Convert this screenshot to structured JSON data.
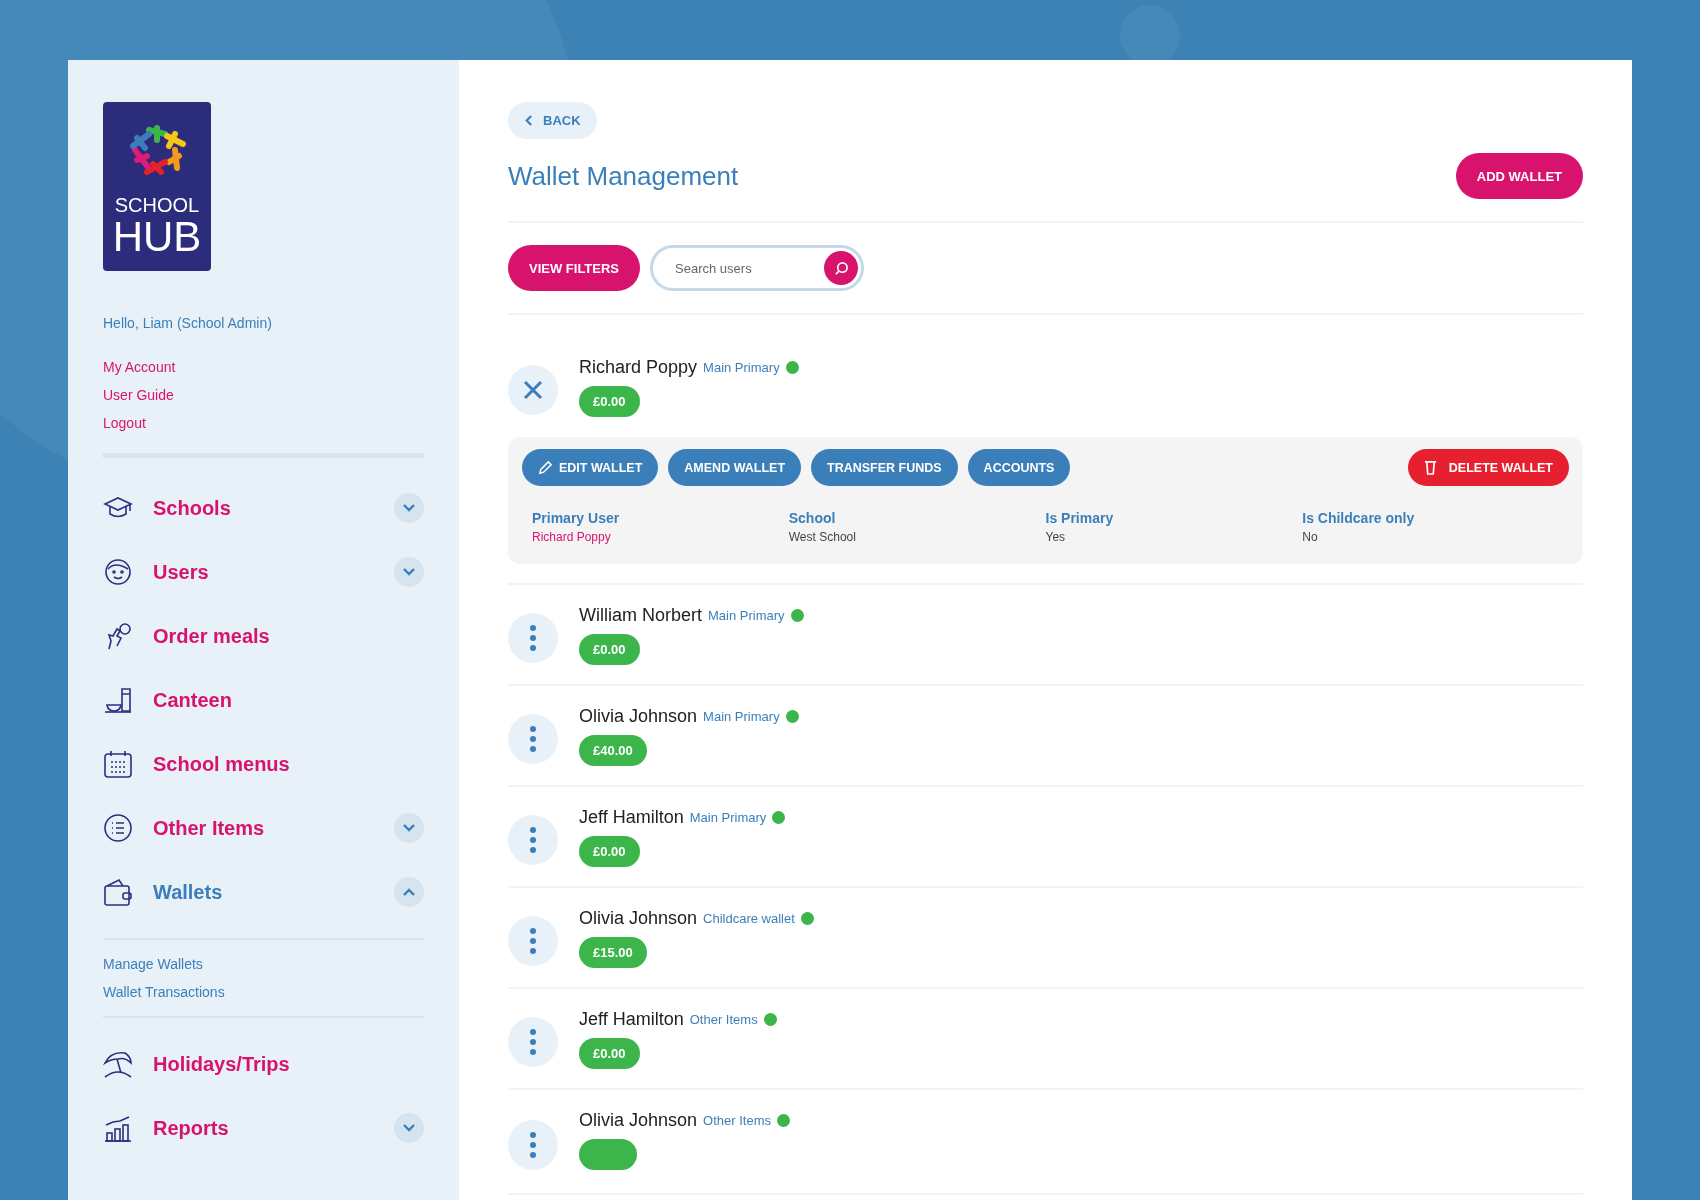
{
  "logo": {
    "line1": "SCHOOL",
    "line2": "HUB"
  },
  "greeting": "Hello, Liam (School Admin)",
  "account_links": [
    "My Account",
    "User Guide",
    "Logout"
  ],
  "sidebar": {
    "items": [
      {
        "label": "Schools",
        "selected": false,
        "expanded": false
      },
      {
        "label": "Users",
        "selected": false,
        "expanded": false
      },
      {
        "label": "Order meals",
        "selected": false
      },
      {
        "label": "Canteen",
        "selected": false
      },
      {
        "label": "School menus",
        "selected": false
      },
      {
        "label": "Other Items",
        "selected": false,
        "expanded": false
      },
      {
        "label": "Wallets",
        "selected": true,
        "expanded": true,
        "children": [
          {
            "label": "Manage Wallets"
          },
          {
            "label": "Wallet Transactions"
          }
        ]
      },
      {
        "label": "Holidays/Trips",
        "selected": false
      },
      {
        "label": "Reports",
        "selected": false,
        "expanded": false
      }
    ]
  },
  "back_button": "BACK",
  "title": "Wallet Management",
  "add_button": "ADD WALLET",
  "filters_button": "VIEW FILTERS",
  "search": {
    "placeholder": "Search users"
  },
  "wallets": [
    {
      "name": "Richard Poppy",
      "type": "Main Primary",
      "balance": "£0.00",
      "expanded": true,
      "actions": [
        {
          "label": "EDIT WALLET",
          "kind": "edit"
        },
        {
          "label": "AMEND WALLET",
          "kind": "plain"
        },
        {
          "label": "TRANSFER FUNDS",
          "kind": "plain"
        },
        {
          "label": "ACCOUNTS",
          "kind": "plain"
        },
        {
          "label": "DELETE WALLET",
          "kind": "delete"
        }
      ],
      "details": [
        {
          "label": "Primary User",
          "value": "Richard Poppy",
          "kind": "link"
        },
        {
          "label": "School",
          "value": "West School",
          "kind": "text"
        },
        {
          "label": "Is Primary",
          "value": "Yes",
          "kind": "text"
        },
        {
          "label": "Is Childcare only",
          "value": "No",
          "kind": "text"
        }
      ]
    },
    {
      "name": "William Norbert",
      "type": "Main Primary",
      "balance": "£0.00",
      "expanded": false
    },
    {
      "name": "Olivia Johnson",
      "type": "Main Primary",
      "balance": "£40.00",
      "expanded": false
    },
    {
      "name": "Jeff Hamilton",
      "type": "Main Primary",
      "balance": "£0.00",
      "expanded": false
    },
    {
      "name": "Olivia Johnson",
      "type": "Childcare wallet",
      "balance": "£15.00",
      "expanded": false
    },
    {
      "name": "Jeff Hamilton",
      "type": "Other Items",
      "balance": "£0.00",
      "expanded": false
    },
    {
      "name": "Olivia Johnson",
      "type": "Other Items",
      "expanded": false
    }
  ]
}
